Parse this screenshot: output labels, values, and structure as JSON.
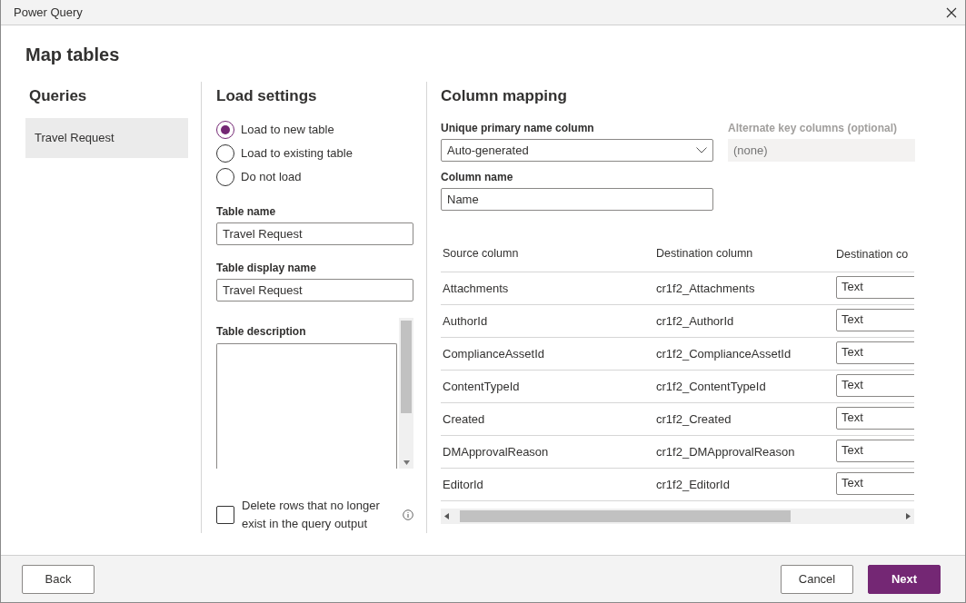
{
  "window": {
    "title": "Power Query"
  },
  "page_title": "Map tables",
  "queries": {
    "heading": "Queries",
    "items": [
      {
        "label": "Travel Request",
        "selected": true
      }
    ]
  },
  "load_settings": {
    "heading": "Load settings",
    "options": [
      {
        "label": "Load to new table",
        "selected": true
      },
      {
        "label": "Load to existing table",
        "selected": false
      },
      {
        "label": "Do not load",
        "selected": false
      }
    ],
    "table_name": {
      "label": "Table name",
      "value": "Travel Request"
    },
    "display_name": {
      "label": "Table display name",
      "value": "Travel Request"
    },
    "description": {
      "label": "Table description"
    },
    "delete_rows": {
      "label": "Delete rows that no longer exist in the query output",
      "checked": false
    }
  },
  "column_mapping": {
    "heading": "Column mapping",
    "primary_name": {
      "label": "Unique primary name column",
      "value": "Auto-generated"
    },
    "alternate_key": {
      "label": "Alternate key columns (optional)",
      "placeholder": "(none)",
      "disabled": true
    },
    "column_name": {
      "label": "Column name",
      "value": "Name"
    },
    "table": {
      "columns": [
        "Source column",
        "Destination column",
        "Destination co"
      ],
      "rows": [
        {
          "source": "Attachments",
          "destination": "cr1f2_Attachments",
          "type": "Text"
        },
        {
          "source": "AuthorId",
          "destination": "cr1f2_AuthorId",
          "type": "Text"
        },
        {
          "source": "ComplianceAssetId",
          "destination": "cr1f2_ComplianceAssetId",
          "type": "Text"
        },
        {
          "source": "ContentTypeId",
          "destination": "cr1f2_ContentTypeId",
          "type": "Text"
        },
        {
          "source": "Created",
          "destination": "cr1f2_Created",
          "type": "Text"
        },
        {
          "source": "DMApprovalReason",
          "destination": "cr1f2_DMApprovalReason",
          "type": "Text"
        },
        {
          "source": "EditorId",
          "destination": "cr1f2_EditorId",
          "type": "Text"
        }
      ]
    }
  },
  "footer": {
    "buttons": [
      {
        "label": "Back",
        "kind": "secondary"
      },
      {
        "label": "Cancel",
        "kind": "secondary"
      },
      {
        "label": "Next",
        "kind": "primary"
      }
    ]
  }
}
